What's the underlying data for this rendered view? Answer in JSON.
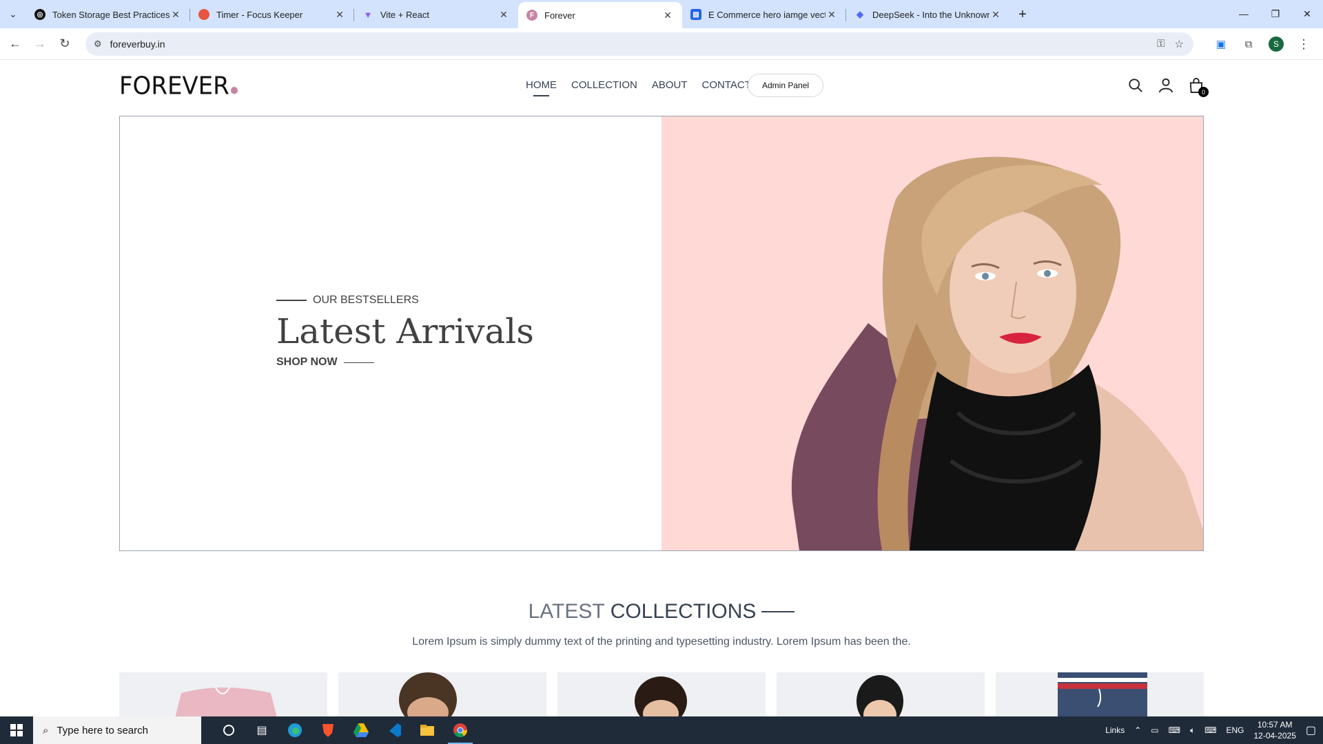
{
  "browser": {
    "tabs": [
      {
        "title": "Token Storage Best Practices",
        "fav_color": "#111111",
        "fav_glyph": "◎"
      },
      {
        "title": "Timer - Focus Keeper",
        "fav_color": "#e8553f",
        "fav_glyph": ""
      },
      {
        "title": "Vite + React",
        "fav_color": "#8b5cf6",
        "fav_glyph": "▼"
      },
      {
        "title": "Forever",
        "fav_color": "#c586a5",
        "fav_glyph": "F"
      },
      {
        "title": "E Commerce hero iamge vector",
        "fav_color": "#2563eb",
        "fav_glyph": "▤"
      },
      {
        "title": "DeepSeek - Into the Unknown",
        "fav_color": "#4d6bfe",
        "fav_glyph": "◆"
      }
    ],
    "active_tab": 3,
    "url": "foreverbuy.in",
    "profile_initial": "S"
  },
  "site": {
    "logo": "FOREVER",
    "menu": [
      "HOME",
      "COLLECTION",
      "ABOUT",
      "CONTACT"
    ],
    "admin_button": "Admin Panel",
    "cart_count": "0",
    "accent": "#c586a5"
  },
  "hero": {
    "kicker": "OUR BESTSELLERS",
    "title": "Latest Arrivals",
    "cta": "SHOP NOW",
    "bg_color": "#ffd9d6"
  },
  "latest": {
    "title_light": "LATEST",
    "title_bold": "COLLECTIONS",
    "subtitle": "Lorem Ipsum is simply dummy text of the printing and typesetting industry. Lorem Ipsum has been the."
  },
  "taskbar": {
    "search_placeholder": "Type here to search",
    "links_label": "Links",
    "lang": "ENG",
    "time": "10:57 AM",
    "date": "12-04-2025"
  }
}
